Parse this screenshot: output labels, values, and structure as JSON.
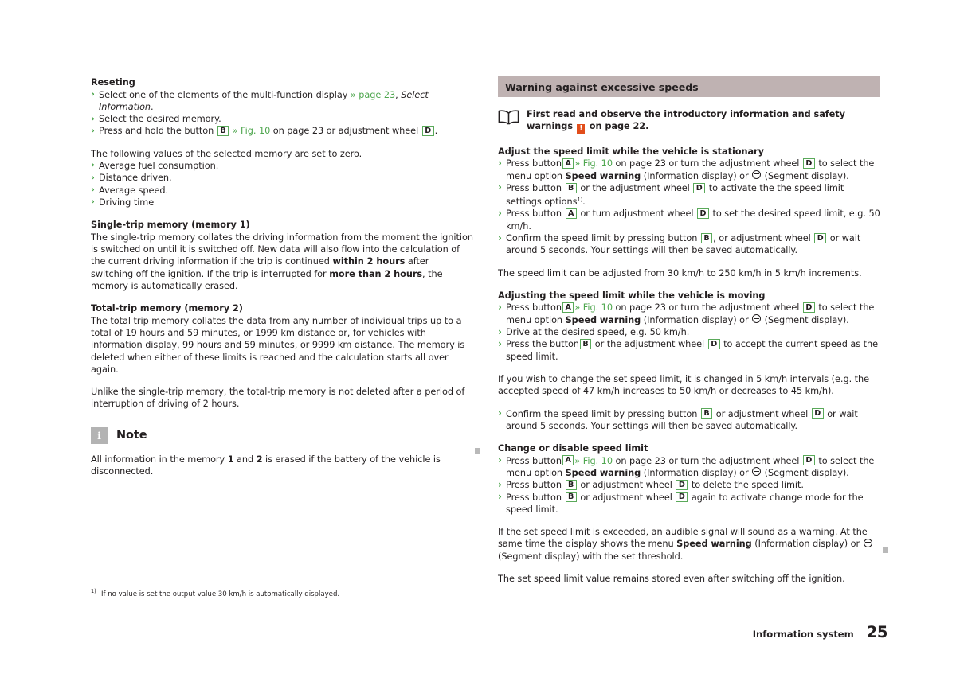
{
  "document": {
    "footer": {
      "chapter": "Information system",
      "page_number": "25"
    },
    "footnote": {
      "marker": "1)",
      "text": "If no value is set the output value 30 km/h is automatically displayed."
    }
  },
  "left_column": {
    "reseting": {
      "heading": "Reseting",
      "bullets": [
        {
          "pre": "Select one of the elements of the multi-function display ",
          "link": "» page 23",
          "post_a": ", ",
          "italic": "Select Information",
          "post_b": "."
        },
        {
          "plain": "Select the desired memory."
        },
        {
          "pre": "Press and hold the button ",
          "key1": "B",
          "mid_a": " ",
          "link": "» Fig. 10",
          "mid_b": " on page 23 or adjustment wheel ",
          "key2": "D",
          "post": "."
        }
      ],
      "intro": "The following values of the selected memory are set to zero.",
      "values": [
        "Average fuel consumption.",
        "Distance driven.",
        "Average speed.",
        "Driving time"
      ]
    },
    "single_trip": {
      "heading": "Single-trip memory (memory 1)",
      "para_1": "The single-trip memory collates the driving information from the moment the ignition is switched on until it is switched off. New data will also flow into the calculation of the current driving information if the trip is continued ",
      "bold_1": "within 2 hours",
      "para_2": " after switching off the ignition. If the trip is interrupted for ",
      "bold_2": "more than 2 hours",
      "para_3": ", the memory is automatically erased."
    },
    "total_trip": {
      "heading": "Total-trip memory (memory 2)",
      "para_1": "The total trip memory collates the data from any number of individual trips up to a total of 19 hours and 59 minutes, or 1999 km distance or, for vehicles with information display, 99 hours and 59 minutes, or 9999 km distance. The memory is deleted when either of these limits is reached and the calculation starts all over again.",
      "para_2": "Unlike the single-trip memory, the total-trip memory is not deleted after a period of interruption of driving of 2 hours."
    },
    "note": {
      "icon_label": "i",
      "title": "Note",
      "text_a": "All information in the memory ",
      "bold_1": "1",
      "text_b": " and ",
      "bold_2": "2",
      "text_c": " is erased if the battery of the vehicle is disconnected."
    }
  },
  "right_column": {
    "section_title": "Warning against excessive speeds",
    "intro_note": {
      "text_a": "First read and observe the introductory information and safety warnings ",
      "warn_symbol": "!",
      "text_b": " on page 22."
    },
    "stationary": {
      "heading": "Adjust the speed limit while the vehicle is stationary",
      "bullets": [
        {
          "pre": "Press button",
          "key1": "A",
          "link": "» Fig. 10",
          "mid": " on page 23 or turn the adjustment wheel ",
          "key2": "D",
          "post_a": " to select the menu option ",
          "bold": "Speed warning",
          "post_b": " (Information display) or ",
          "seg": true,
          "post_c": " (Segment display)."
        },
        {
          "pre": "Press button ",
          "key1": "B",
          "mid": " or the adjustment wheel ",
          "key2": "D",
          "post_a": " to activate the the speed limit settings options",
          "sup": "1)",
          "post_b": "."
        },
        {
          "pre": "Press button ",
          "key1": "A",
          "mid": " or turn adjustment wheel ",
          "key2": "D",
          "post_a": " to set the desired speed limit, e.g. 50 km/h."
        },
        {
          "pre": "Confirm the speed limit by pressing button ",
          "key1": "B",
          "mid": ", or adjustment wheel ",
          "key2": "D",
          "post_a": " or wait around 5 seconds. Your settings will then be saved automatically."
        }
      ],
      "para": "The speed limit can be adjusted from 30 km/h to 250 km/h in 5 km/h increments."
    },
    "moving": {
      "heading": "Adjusting the speed limit while the vehicle is moving",
      "bullets": [
        {
          "pre": "Press button",
          "key1": "A",
          "link": "» Fig. 10",
          "mid": " on page 23 or turn the adjustment wheel ",
          "key2": "D",
          "post_a": " to select the menu option ",
          "bold": "Speed warning",
          "post_b": " (Information display) or ",
          "seg": true,
          "post_c": " (Segment display)."
        },
        {
          "plain": "Drive at the desired speed, e.g. 50 km/h."
        },
        {
          "pre": "Press the button",
          "key1": "B",
          "mid": " or the adjustment wheel ",
          "key2": "D",
          "post_a": " to accept the current speed as the speed limit."
        }
      ],
      "para": "If you wish to change the set speed limit, it is changed in 5 km/h intervals (e.g. the accepted speed of 47 km/h increases to 50 km/h or decreases to 45 km/h).",
      "confirm_bullet": {
        "pre": "Confirm the speed limit by pressing button ",
        "key1": "B",
        "mid": " or adjustment wheel ",
        "key2": "D",
        "post_a": " or wait around 5 seconds. Your settings will then be saved automatically."
      }
    },
    "change_disable": {
      "heading": "Change or disable speed limit",
      "bullets": [
        {
          "pre": "Press button",
          "key1": "A",
          "link": "» Fig. 10",
          "mid": " on page 23 or turn the adjustment wheel ",
          "key2": "D",
          "post_a": " to select the menu option ",
          "bold": "Speed warning",
          "post_b": " (Information display) or ",
          "seg": true,
          "post_c": " (Segment display)."
        },
        {
          "pre": "Press button ",
          "key1": "B",
          "mid": " or adjustment wheel ",
          "key2": "D",
          "post_a": " to delete the speed limit."
        },
        {
          "pre": "Press button ",
          "key1": "B",
          "mid": " or adjustment wheel ",
          "key2": "D",
          "post_a": " again to activate change mode for the speed limit."
        }
      ],
      "para_1_a": "If the set speed limit is exceeded, an audible signal will sound as a warning. At the same time the display shows the menu ",
      "para_1_bold": "Speed warning",
      "para_1_b": " (Information display) or ",
      "para_1_c": " (Segment display) with the set threshold.",
      "para_2": "The set speed limit value remains stored even after switching off the ignition."
    }
  }
}
